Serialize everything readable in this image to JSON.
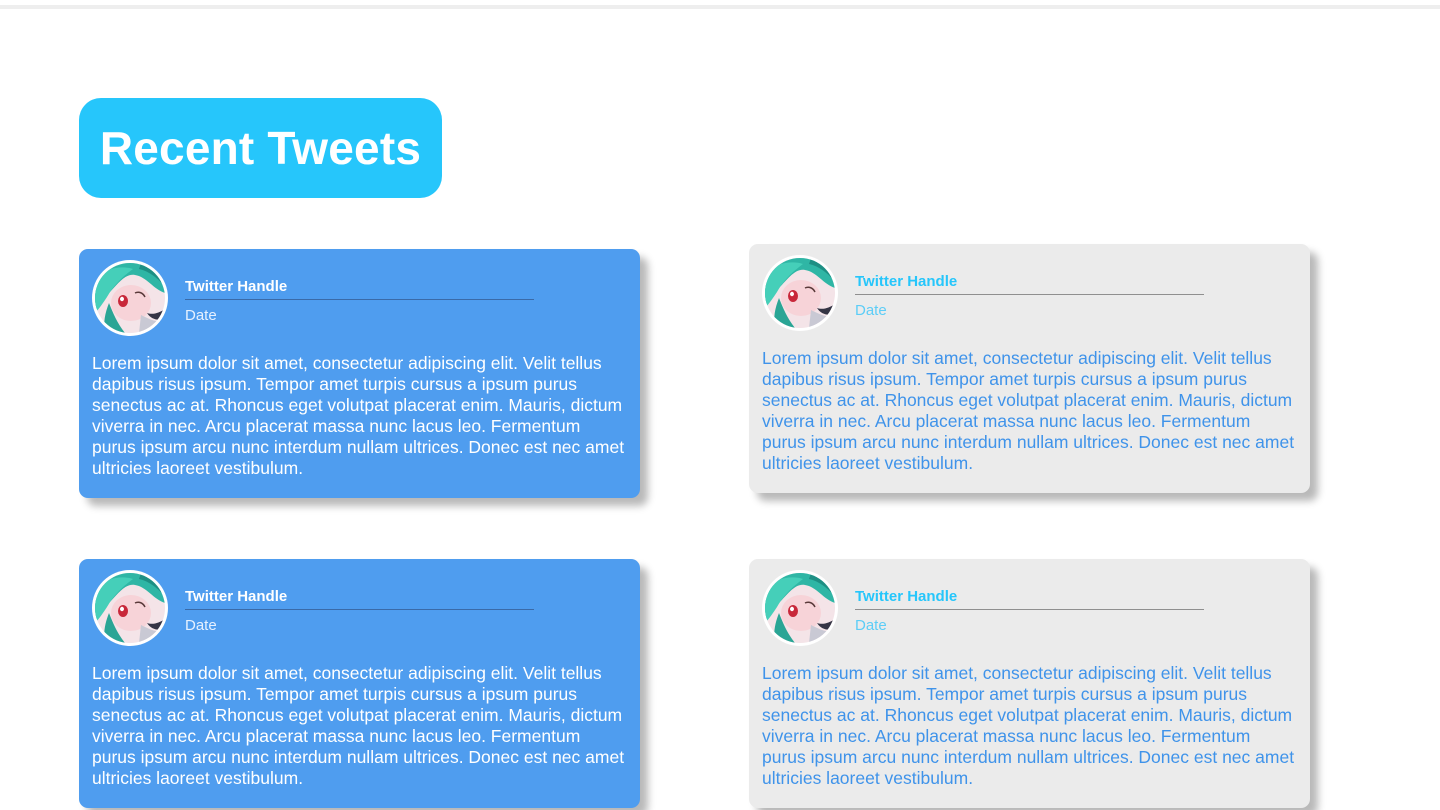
{
  "page": {
    "title": "Recent Tweets"
  },
  "colors": {
    "accent": "#26c6fb",
    "card_blue": "#4f9def",
    "card_gray": "#ebebeb"
  },
  "tweets": [
    {
      "style": "blue",
      "avatar_icon": "anime-avatar-icon",
      "handle": "Twitter Handle",
      "date": "Date",
      "text": "Lorem ipsum dolor sit amet, consectetur adipiscing elit. Velit tellus dapibus risus ipsum. Tempor amet turpis cursus a ipsum purus senectus ac at. Rhoncus eget volutpat placerat enim. Mauris, dictum viverra in nec. Arcu placerat massa nunc lacus leo. Fermentum purus ipsum arcu nunc interdum nullam ultrices. Donec est nec amet ultricies laoreet vestibulum."
    },
    {
      "style": "gray",
      "avatar_icon": "anime-avatar-icon",
      "handle": "Twitter Handle",
      "date": "Date",
      "text": "Lorem ipsum dolor sit amet, consectetur adipiscing elit. Velit tellus dapibus risus ipsum. Tempor amet turpis cursus a ipsum purus senectus ac at. Rhoncus eget volutpat placerat enim. Mauris, dictum viverra in nec. Arcu placerat massa nunc lacus leo. Fermentum purus ipsum arcu nunc interdum nullam ultrices. Donec est nec amet ultricies laoreet vestibulum."
    },
    {
      "style": "blue",
      "avatar_icon": "anime-avatar-icon",
      "handle": "Twitter Handle",
      "date": "Date",
      "text": "Lorem ipsum dolor sit amet, consectetur adipiscing elit. Velit tellus dapibus risus ipsum. Tempor amet turpis cursus a ipsum purus senectus ac at. Rhoncus eget volutpat placerat enim. Mauris, dictum viverra in nec. Arcu placerat massa nunc lacus leo. Fermentum purus ipsum arcu nunc interdum nullam ultrices. Donec est nec amet ultricies laoreet vestibulum."
    },
    {
      "style": "gray",
      "avatar_icon": "anime-avatar-icon",
      "handle": "Twitter Handle",
      "date": "Date",
      "text": "Lorem ipsum dolor sit amet, consectetur adipiscing elit. Velit tellus dapibus risus ipsum. Tempor amet turpis cursus a ipsum purus senectus ac at. Rhoncus eget volutpat placerat enim. Mauris, dictum viverra in nec. Arcu placerat massa nunc lacus leo. Fermentum purus ipsum arcu nunc interdum nullam ultrices. Donec est nec amet ultricies laoreet vestibulum."
    }
  ]
}
